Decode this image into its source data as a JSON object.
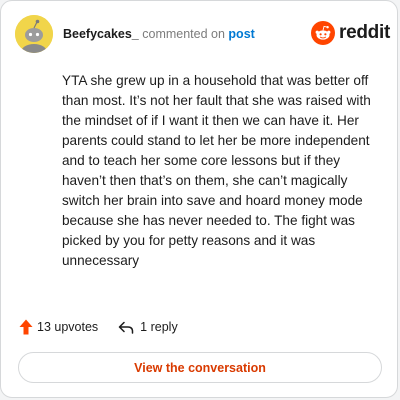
{
  "header": {
    "username": "Beefycakes_",
    "commented_text": "commented on",
    "post_link": "post"
  },
  "brand": {
    "logo_text": "reddit",
    "accent_color": "#ff4500"
  },
  "comment": {
    "body": "YTA she grew up in a household that was better off than most. It’s not her fault that she was raised with the mindset of if I want it then we can have it. Her parents could stand to let her be more independent and to teach her some core lessons but if they haven’t then that’s on them, she can’t magically switch her brain into save and hoard money mode because she has never needed to. The fight was picked by you for petty reasons and it was unnecessary"
  },
  "actions": {
    "upvotes": "13 upvotes",
    "replies": "1 reply",
    "upvote_icon": "upvote-arrow-icon",
    "reply_icon": "reply-arrow-icon"
  },
  "cta": {
    "label": "View the conversation",
    "color": "#d93a00"
  }
}
